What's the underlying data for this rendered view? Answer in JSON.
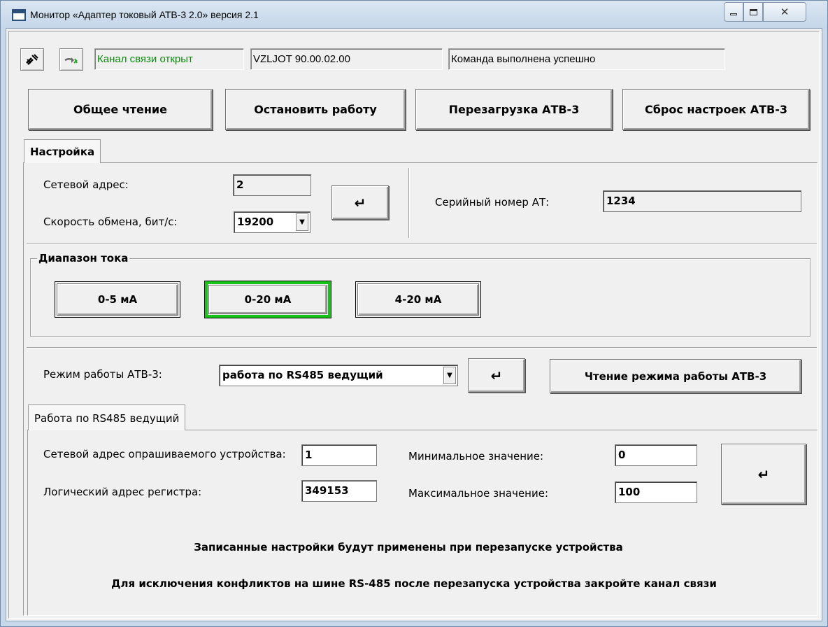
{
  "window": {
    "title": "Монитор «Адаптер токовый АТВ-3 2.0» версия 2.1",
    "close_glyph": "✕"
  },
  "toolbar": {
    "channel_status": "Канал связи открыт",
    "channel_status_color": "#0a8a0a",
    "device_version": "VZLJOT 90.00.02.00",
    "command_status": "Команда выполнена успешно"
  },
  "actions": {
    "general_read": "Общее чтение",
    "stop_work": "Остановить работу",
    "reboot": "Перезагрузка АТВ-3",
    "reset_settings": "Сброс настроек АТВ-3"
  },
  "settings_tab": {
    "label": "Настройка",
    "network_address_label": "Сетевой адрес:",
    "network_address_value": "2",
    "baud_rate_label": "Скорость обмена, бит/с:",
    "baud_rate_value": "19200",
    "serial_label": "Серийный номер АТ:",
    "serial_value": "1234",
    "enter_glyph": "↵"
  },
  "current_range": {
    "title": "Диапазон тока",
    "options": [
      "0-5 мА",
      "0-20 мА",
      "4-20 мА"
    ],
    "selected": "0-20 мА",
    "selected_color": "#18c318"
  },
  "mode": {
    "label": "Режим работы АТВ-3:",
    "value": "работа по RS485 ведущий",
    "read_button": "Чтение режима работы АТВ-3"
  },
  "rs485_tab": {
    "label": "Работа по RS485 ведущий",
    "polled_address_label": "Сетевой адрес опрашиваемого устройства:",
    "polled_address_value": "1",
    "register_label": "Логический адрес регистра:",
    "register_value": "349153",
    "min_label": "Минимальное значение:",
    "min_value": "0",
    "max_label": "Максимальное значение:",
    "max_value": "100"
  },
  "notes": {
    "line1": "Записанные настройки будут применены при перезапуске устройства",
    "line2": "Для исключения конфликтов на шине RS-485 после перезапуска устройства закройте канал связи"
  }
}
